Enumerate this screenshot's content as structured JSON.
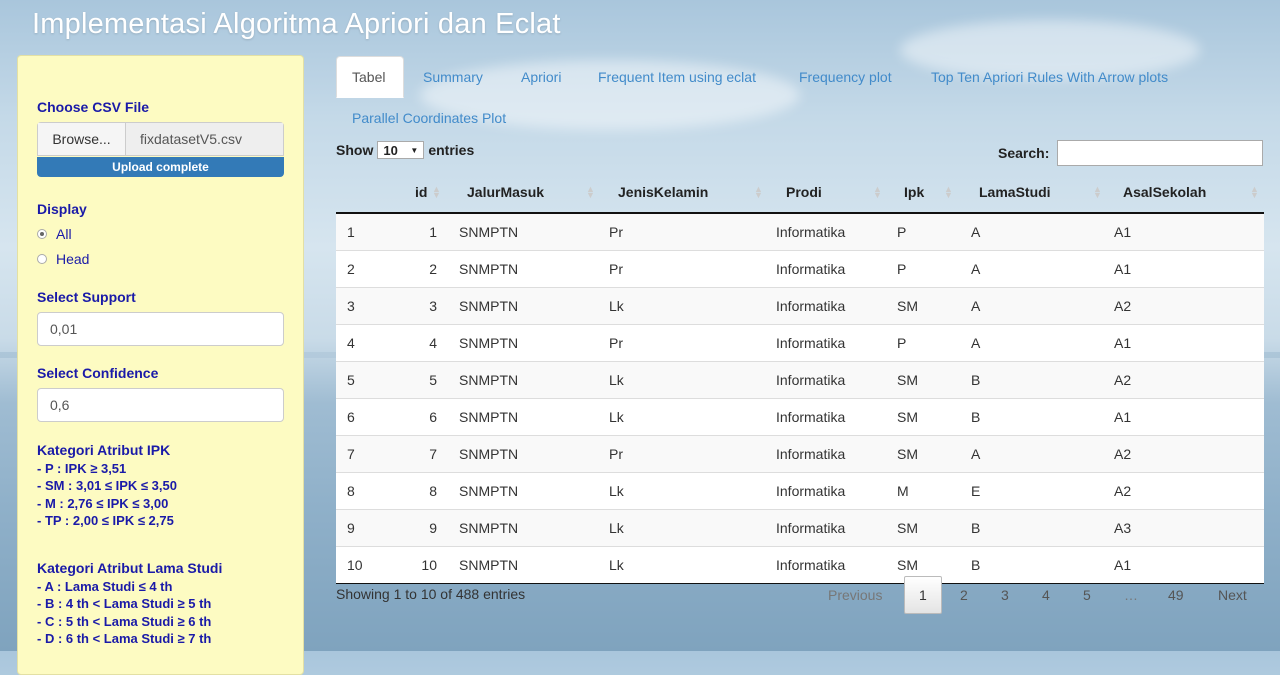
{
  "app_title": "Implementasi Algoritma Apriori dan Eclat",
  "sidebar": {
    "csv_label": "Choose CSV File",
    "browse_label": "Browse...",
    "file_name": "fixdatasetV5.csv",
    "upload_status": "Upload complete",
    "display_label": "Display",
    "display_options": [
      {
        "label": "All",
        "selected": true
      },
      {
        "label": "Head",
        "selected": false
      }
    ],
    "support_label": "Select Support",
    "support_value": "0,01",
    "confidence_label": "Select Confidence",
    "confidence_value": "0,6",
    "ipk_heading": "Kategori Atribut IPK",
    "ipk_items": [
      "- P : IPK ≥ 3,51",
      "- SM : 3,01 ≤ IPK ≤ 3,50",
      "- M : 2,76 ≤ IPK ≤ 3,00",
      "- TP : 2,00 ≤ IPK ≤ 2,75"
    ],
    "lama_heading": "Kategori Atribut Lama Studi",
    "lama_items": [
      "- A : Lama Studi ≤ 4 th",
      "- B : 4 th < Lama Studi ≥ 5 th",
      "- C : 5 th < Lama Studi ≥ 6 th",
      "- D : 6 th < Lama Studi ≥ 7 th"
    ]
  },
  "tabs": [
    {
      "label": "Tabel",
      "active": true
    },
    {
      "label": "Summary"
    },
    {
      "label": "Apriori"
    },
    {
      "label": "Frequent Item using eclat"
    },
    {
      "label": "Frequency plot"
    },
    {
      "label": "Top Ten Apriori Rules With Arrow plots"
    },
    {
      "label": "Parallel Coordinates Plot"
    }
  ],
  "table_controls": {
    "show_label": "Show",
    "entries_value": "10",
    "entries_label": "entries",
    "search_label": "Search:"
  },
  "table": {
    "columns": [
      "",
      "id",
      "JalurMasuk",
      "JenisKelamin",
      "Prodi",
      "Ipk",
      "LamaStudi",
      "AsalSekolah"
    ],
    "rows": [
      [
        "1",
        "1",
        "SNMPTN",
        "Pr",
        "Informatika",
        "P",
        "A",
        "A1"
      ],
      [
        "2",
        "2",
        "SNMPTN",
        "Pr",
        "Informatika",
        "P",
        "A",
        "A1"
      ],
      [
        "3",
        "3",
        "SNMPTN",
        "Lk",
        "Informatika",
        "SM",
        "A",
        "A2"
      ],
      [
        "4",
        "4",
        "SNMPTN",
        "Pr",
        "Informatika",
        "P",
        "A",
        "A1"
      ],
      [
        "5",
        "5",
        "SNMPTN",
        "Lk",
        "Informatika",
        "SM",
        "B",
        "A2"
      ],
      [
        "6",
        "6",
        "SNMPTN",
        "Lk",
        "Informatika",
        "SM",
        "B",
        "A1"
      ],
      [
        "7",
        "7",
        "SNMPTN",
        "Pr",
        "Informatika",
        "SM",
        "A",
        "A2"
      ],
      [
        "8",
        "8",
        "SNMPTN",
        "Lk",
        "Informatika",
        "M",
        "E",
        "A2"
      ],
      [
        "9",
        "9",
        "SNMPTN",
        "Lk",
        "Informatika",
        "SM",
        "B",
        "A3"
      ],
      [
        "10",
        "10",
        "SNMPTN",
        "Lk",
        "Informatika",
        "SM",
        "B",
        "A1"
      ]
    ]
  },
  "table_info": "Showing 1 to 10 of 488 entries",
  "pagination": {
    "previous": "Previous",
    "pages": [
      "1",
      "2",
      "3",
      "4",
      "5",
      "…",
      "49"
    ],
    "current": "1",
    "next": "Next"
  }
}
